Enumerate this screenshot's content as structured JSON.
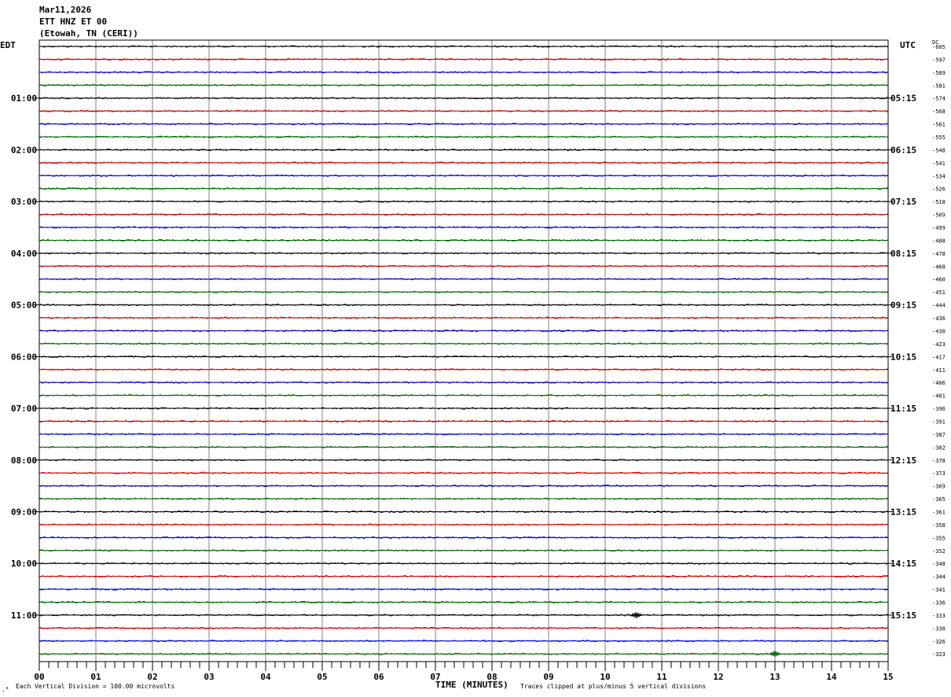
{
  "header": {
    "date": "Mar11,2026",
    "station": "ETT HNZ ET 00",
    "location": "(Etowah, TN (CERI))"
  },
  "labels": {
    "left_tz": "EDT",
    "right_tz": "UTC",
    "dc_label": "DC",
    "footer_scale": "Each Vertical Division =  100.00 microvolts",
    "footer_clip": "Traces clipped at plus/minus 5 vertical divisions"
  },
  "colors": {
    "trace_cycle": [
      "#000000",
      "#cc0000",
      "#0000cc",
      "#006600"
    ],
    "grid": "#808080"
  },
  "chart_data": {
    "type": "line",
    "title": "ETT HNZ ET 00",
    "xlabel": "TIME (MINUTES)",
    "ylabel": "",
    "xlim": [
      0,
      15
    ],
    "x_ticks": [
      "00",
      "01",
      "02",
      "03",
      "04",
      "05",
      "06",
      "07",
      "08",
      "09",
      "10",
      "11",
      "12",
      "13",
      "14",
      "15"
    ],
    "rows_per_hour": 4,
    "left_hour_labels": [
      "01:00",
      "02:00",
      "03:00",
      "04:00",
      "05:00",
      "06:00",
      "07:00",
      "08:00",
      "09:00",
      "10:00",
      "11:00"
    ],
    "right_hour_labels": [
      "05:15",
      "06:15",
      "07:15",
      "08:15",
      "09:15",
      "10:15",
      "11:15",
      "12:15",
      "13:15",
      "14:15",
      "15:15"
    ],
    "dc_offsets": [
      "-605",
      "-597",
      "-589",
      "-581",
      "-574",
      "-568",
      "-561",
      "-555",
      "-548",
      "-541",
      "-534",
      "-526",
      "-518",
      "-509",
      "-499",
      "-488",
      "-478",
      "-468",
      "-460",
      "-451",
      "-444",
      "-436",
      "-430",
      "-423",
      "-417",
      "-411",
      "-406",
      "-401",
      "-396",
      "-391",
      "-387",
      "-382",
      "-378",
      "-373",
      "-369",
      "-365",
      "-361",
      "-358",
      "-355",
      "-352",
      "-348",
      "-344",
      "-341",
      "-336",
      "-333",
      "-330",
      "-326",
      "-323"
    ],
    "events": [
      {
        "row": 44,
        "minute": 10.55,
        "amplitude": "small"
      },
      {
        "row": 47,
        "minute": 13.0,
        "amplitude": "small"
      }
    ]
  }
}
